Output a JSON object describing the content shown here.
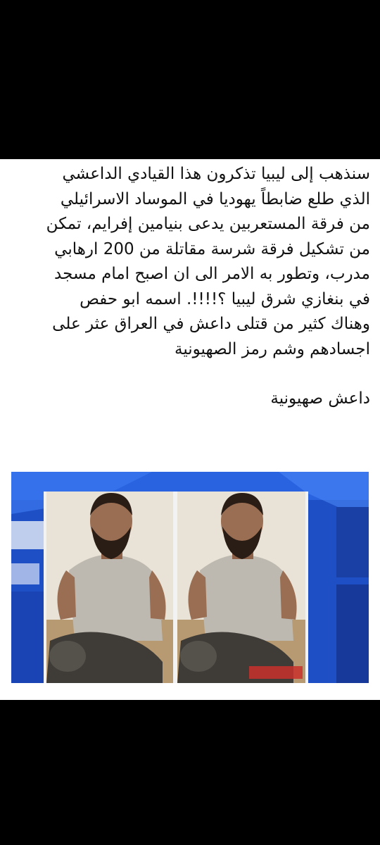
{
  "post": {
    "lines": [
      "سنذهب إلى ليبيا تذكرون هذا القيادي الداعشي",
      "الذي طلع ضابطاً يهوديا في الموساد الاسرائيلي",
      "من فرقة المستعربين يدعى  بنيامين إفرايم، تمكن",
      "من تشكيل فرقة شرسة مقاتلة من 200 ارهابي",
      "مدرب، وتطور به الامر الى ان اصبح امام مسجد",
      "في بنغازي شرق ليبيا ؟!!!!. اسمه ابو حفص",
      "وهناك كثير من قتلى داعش في العراق عثر على",
      "اجسادهم وشم رمز الصهيونية"
    ],
    "tagline": "داعش صهيونية"
  },
  "media": {
    "description_icon": "news-photo-icon",
    "colors": {
      "background_blue": "#1e4fc4",
      "wall": "#e9e2d6",
      "floor": "#b79a72",
      "shirt": "#bdb9b0",
      "skin": "#9a6e52",
      "beard": "#2a1d16",
      "pants": "#3f3c38"
    }
  }
}
